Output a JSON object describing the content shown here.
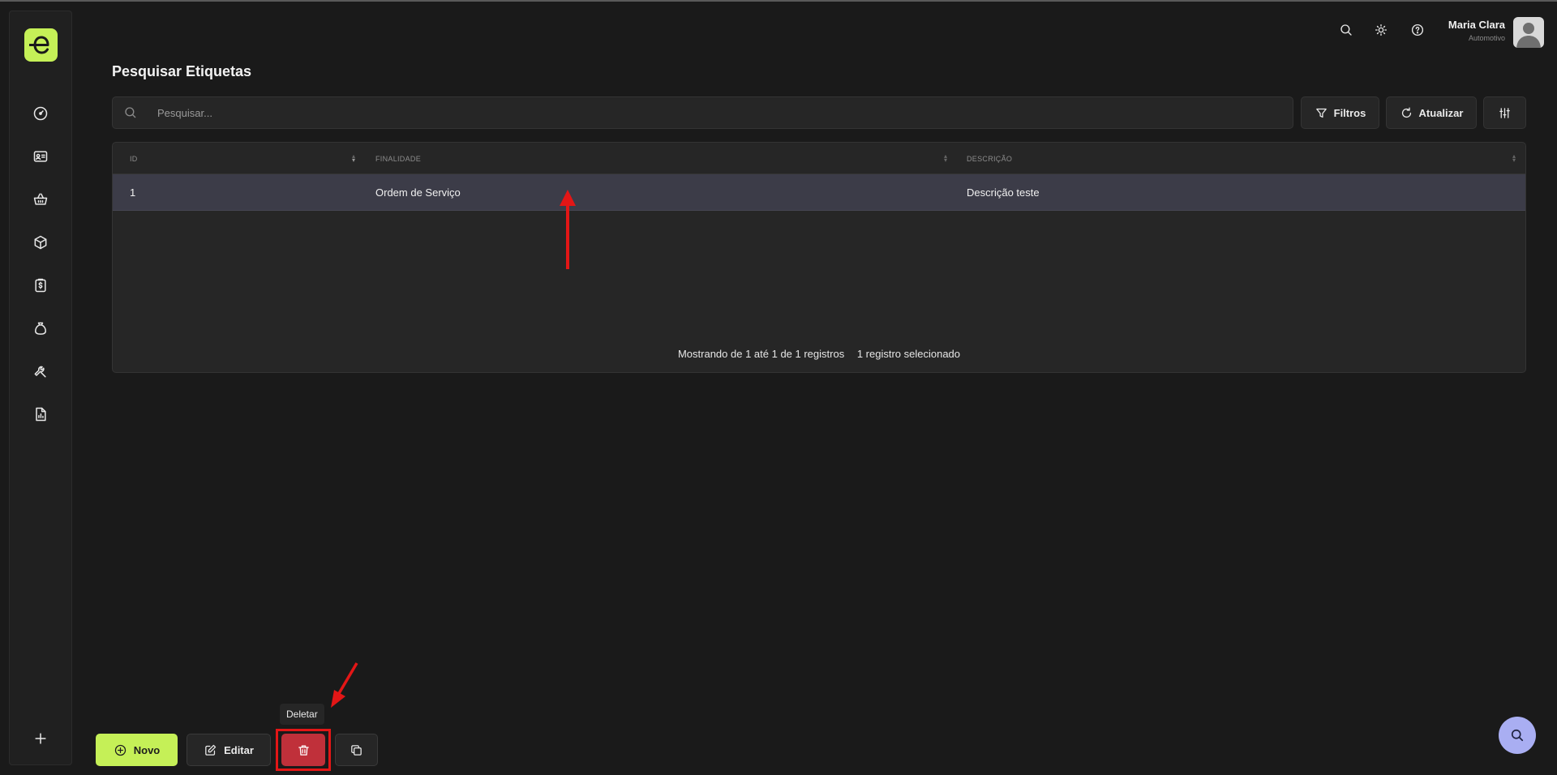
{
  "header": {
    "user_name": "Maria Clara",
    "user_org": "Automotivo"
  },
  "page": {
    "title": "Pesquisar Etiquetas"
  },
  "search": {
    "placeholder": "Pesquisar...",
    "value": ""
  },
  "toolbar": {
    "filters_label": "Filtros",
    "refresh_label": "Atualizar"
  },
  "table": {
    "columns": [
      "ID",
      "FINALIDADE",
      "DESCRIÇÃO"
    ],
    "rows": [
      {
        "id": "1",
        "finalidade": "Ordem de Serviço",
        "descricao": "Descrição teste",
        "selected": true
      }
    ],
    "footer_count": "Mostrando de 1 até 1 de 1 registros",
    "footer_selected": "1 registro selecionado"
  },
  "actions": {
    "new_label": "Novo",
    "edit_label": "Editar",
    "delete_tooltip": "Deletar"
  },
  "sidebar": {
    "icons": [
      "dashboard-icon",
      "contact-card-icon",
      "basket-icon",
      "package-icon",
      "billing-clipboard-icon",
      "money-bag-icon",
      "wrench-icon",
      "report-icon",
      "plus-icon"
    ]
  },
  "colors": {
    "accent": "#c5f057",
    "selected_row": "#3c3c48",
    "delete": "#c0303a",
    "annotation": "#e31616",
    "fab": "#a9aef2"
  }
}
